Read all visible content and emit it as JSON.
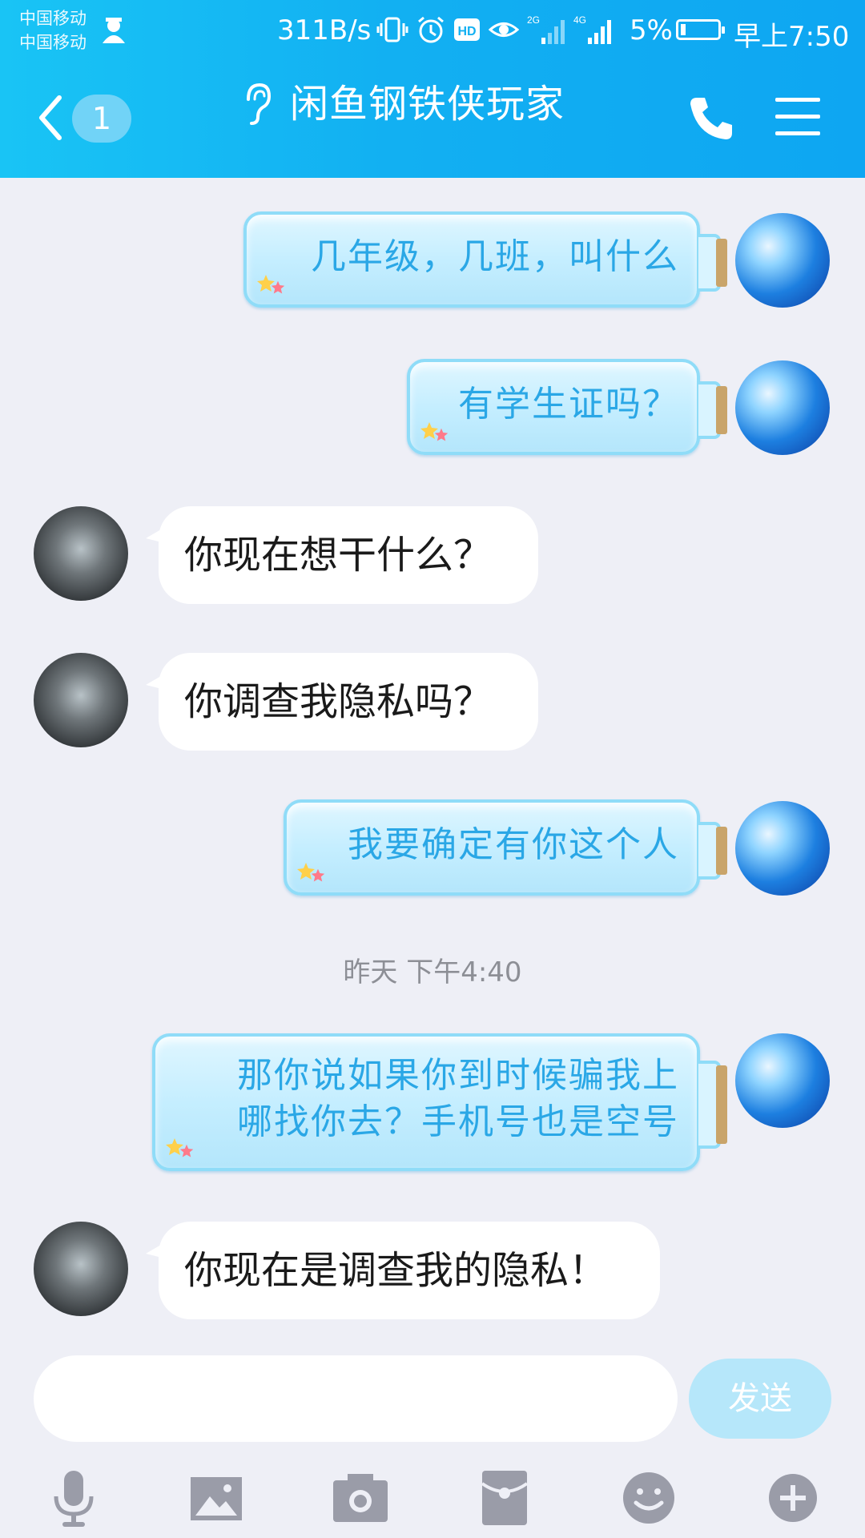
{
  "status_bar": {
    "carrier_1": "中国移动",
    "carrier_2": "中国移动",
    "net_speed": "311B/s",
    "network_labels": [
      "2G",
      "4G"
    ],
    "battery": "5%",
    "time": "早上7:50"
  },
  "header": {
    "unread_count": "1",
    "title": "闲鱼钢铁侠玩家"
  },
  "messages": [
    {
      "side": "right",
      "text": "几年级，几班，叫什么"
    },
    {
      "side": "right",
      "text": "有学生证吗？"
    },
    {
      "side": "left",
      "text": "你现在想干什么？"
    },
    {
      "side": "left",
      "text": "你调查我隐私吗？"
    },
    {
      "side": "right",
      "text": "我要确定有你这个人"
    },
    {
      "side": "right",
      "line1": "那你说如果你到时候骗我上",
      "line2": "哪找你去？手机号也是空号"
    },
    {
      "side": "left",
      "text": "你现在是调查我的隐私！"
    }
  ],
  "timestamp": "昨天 下午4:40",
  "composer": {
    "input_value": "",
    "send_label": "发送"
  },
  "toolbar_icons": [
    "microphone-icon",
    "image-icon",
    "camera-icon",
    "red-packet-icon",
    "emoji-icon",
    "plus-icon"
  ],
  "colors": {
    "header": "#12b0f2",
    "background": "#eeeff6",
    "bottle_text": "#2aa7e6",
    "send_button": "#b6e7fa"
  }
}
